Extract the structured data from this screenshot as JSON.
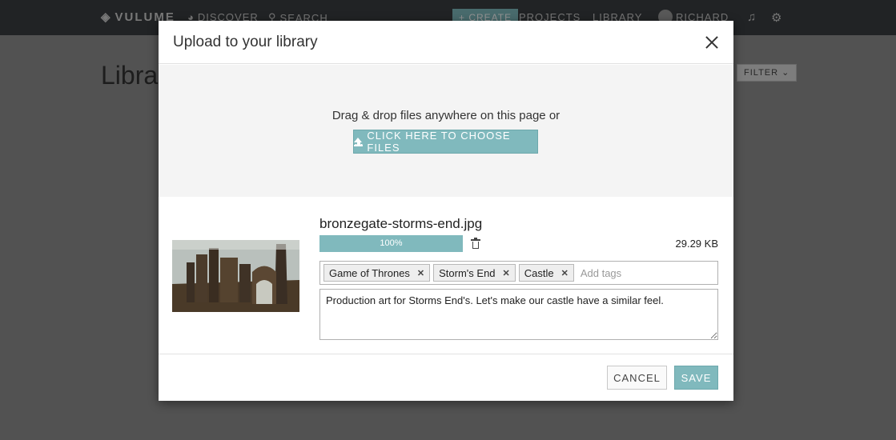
{
  "topnav": {
    "brand": "VULUME",
    "discover": "DISCOVER",
    "search": "SEARCH",
    "create": "+ CREATE",
    "projects": "PROJECTS",
    "library": "LIBRARY",
    "user": "RICHARD",
    "icons": [
      "globe-icon",
      "search-icon",
      "bell-icon",
      "gear-icon"
    ]
  },
  "page": {
    "title": "Library",
    "filter_label": "FILTER ⌄"
  },
  "modal": {
    "title": "Upload to your library",
    "drop_text": "Drag & drop files anywhere on this page or",
    "choose_files_label": "CLICK HERE TO CHOOSE FILES",
    "file": {
      "name": "bronzegate-storms-end.jpg",
      "progress_percent": 100,
      "progress_label": "100%",
      "size": "29.29 KB",
      "tags": [
        "Game of Thrones",
        "Storm's End",
        "Castle"
      ],
      "tags_placeholder": "Add tags",
      "description": "Production art for Storms End's. Let's make our castle have a similar feel."
    },
    "cancel_label": "CANCEL",
    "save_label": "SAVE"
  },
  "colors": {
    "accent": "#80b9bd",
    "nav_bg": "#3a3d40"
  }
}
